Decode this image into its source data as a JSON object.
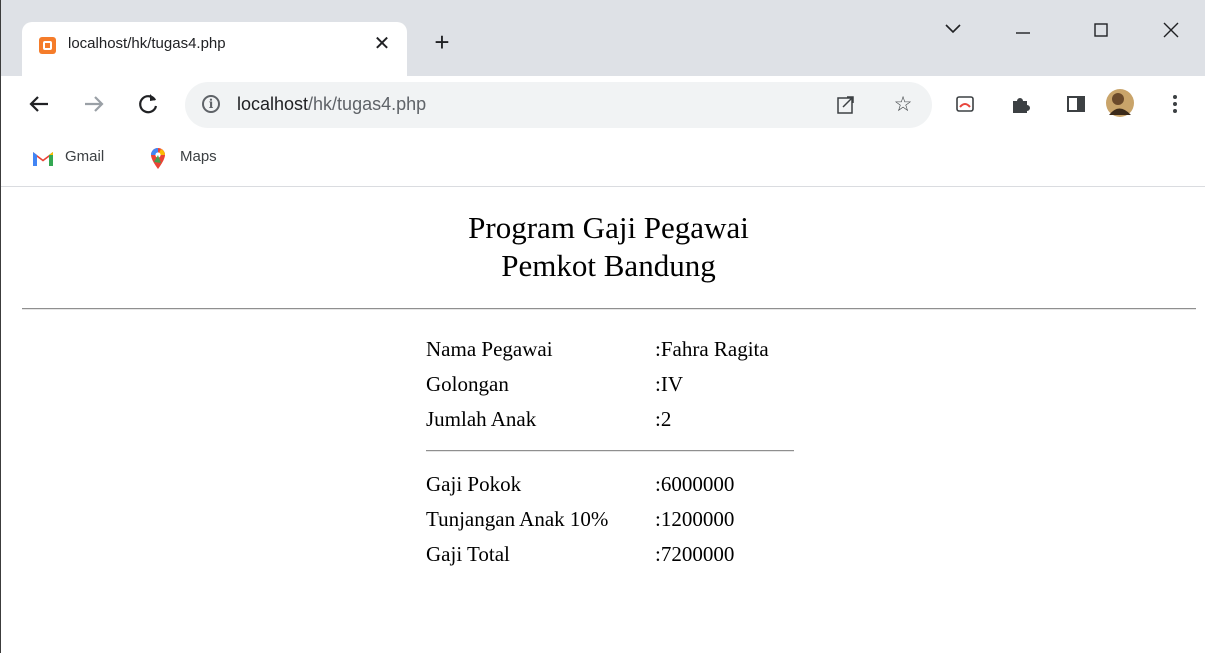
{
  "browser": {
    "tab": {
      "title": "localhost/hk/tugas4.php",
      "close": "✕"
    },
    "new_tab": "+",
    "window": {
      "chevron": "⌄",
      "minimize": "—",
      "maximize": "☐",
      "close": "✕"
    },
    "nav": {
      "back": "←",
      "forward": "→",
      "reload": "C"
    },
    "address": {
      "host": "localhost",
      "path": "/hk/tugas4.php"
    },
    "bookmarks": [
      {
        "label": "Gmail"
      },
      {
        "label": "Maps"
      }
    ]
  },
  "page": {
    "title_line1": "Program Gaji Pegawai",
    "title_line2": "Pemkot Bandung",
    "employee": [
      {
        "label": "Nama Pegawai",
        "value": ":Fahra Ragita"
      },
      {
        "label": "Golongan",
        "value": ":IV"
      },
      {
        "label": "Jumlah Anak",
        "value": ":2"
      }
    ],
    "salary": [
      {
        "label": "Gaji Pokok",
        "value": ":6000000"
      },
      {
        "label": "Tunjangan Anak 10%",
        "value": ":1200000"
      },
      {
        "label": "Gaji Total",
        "value": ":7200000"
      }
    ]
  }
}
